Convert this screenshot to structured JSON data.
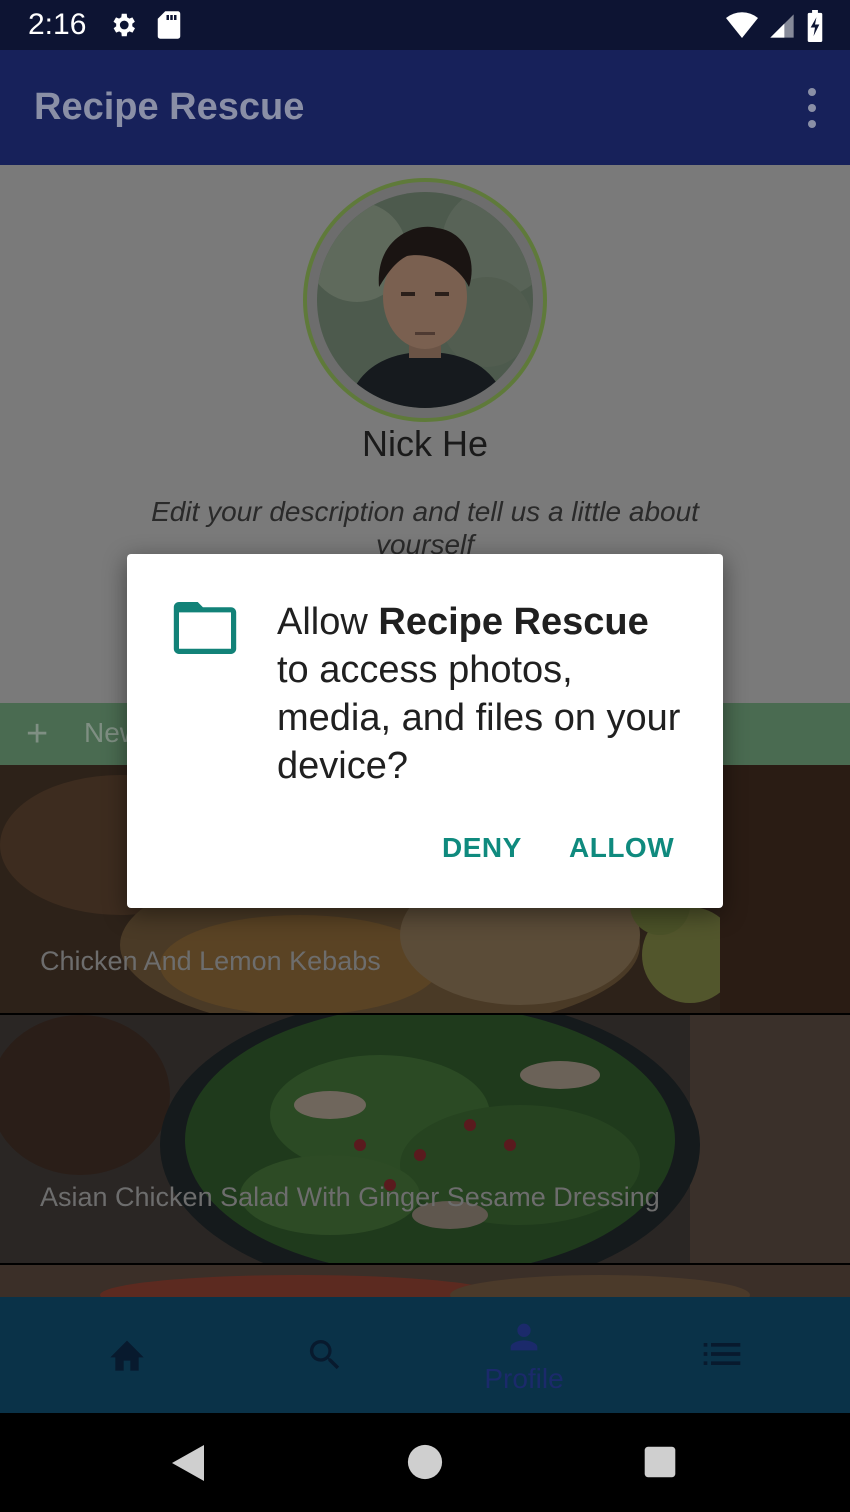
{
  "status_bar": {
    "time": "2:16"
  },
  "app_bar": {
    "title": "Recipe Rescue"
  },
  "profile": {
    "name": "Nick He",
    "description": "Edit your description and tell us a little about yourself"
  },
  "new_recipe": {
    "label": "New"
  },
  "recipes": [
    {
      "title": "Chicken And Lemon Kebabs"
    },
    {
      "title": "Asian Chicken Salad With Ginger Sesame Dressing"
    }
  ],
  "bottom_nav": {
    "items": [
      {
        "icon": "home-icon",
        "label": ""
      },
      {
        "icon": "search-icon",
        "label": ""
      },
      {
        "icon": "person-icon",
        "label": "Profile"
      },
      {
        "icon": "list-icon",
        "label": ""
      }
    ]
  },
  "dialog": {
    "message_prefix": "Allow ",
    "app_name": "Recipe Rescue",
    "message_suffix": " to access photos, media, and files on your device?",
    "deny_label": "DENY",
    "allow_label": "ALLOW",
    "icon": "folder-icon"
  },
  "colors": {
    "app_bar": "#17215a",
    "accent": "#0f8a7e",
    "new_bar": "#4a6b51",
    "bottom_nav": "#0a3248",
    "nav_active": "#1b2a6b"
  }
}
